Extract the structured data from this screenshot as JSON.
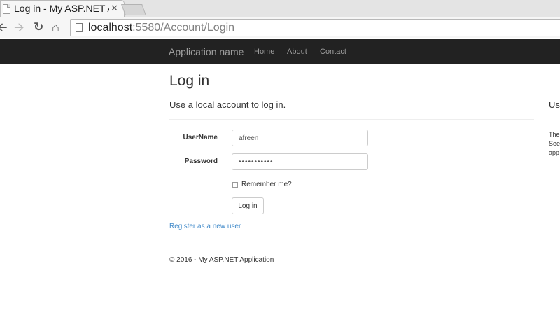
{
  "browser": {
    "tab_title": "Log in - My ASP.NET Application",
    "tab_close": "✕",
    "url_host": "localhost",
    "url_rest": ":5580/Account/Login",
    "icons": {
      "back": "arrow-left-icon",
      "forward": "arrow-right-icon",
      "reload": "reload-icon",
      "home": "home-icon"
    }
  },
  "navbar": {
    "brand": "Application name",
    "links": [
      "Home",
      "About",
      "Contact"
    ]
  },
  "page": {
    "title": "Log in",
    "subtitle": "Use a local account to log in.",
    "right_heading": "Use",
    "right_lines": [
      "The",
      "See",
      "app"
    ]
  },
  "form": {
    "username_label": "UserName",
    "username_value": "afreen",
    "password_label": "Password",
    "password_value": "•••••••••••",
    "remember_label": "Remember me?",
    "remember_checked": false,
    "submit_label": "Log in"
  },
  "register_link": "Register as a new user",
  "footer": "© 2016 - My ASP.NET Application",
  "colors": {
    "navbar_bg": "#222222",
    "link": "#428bca",
    "nav_text": "#9d9d9d"
  }
}
